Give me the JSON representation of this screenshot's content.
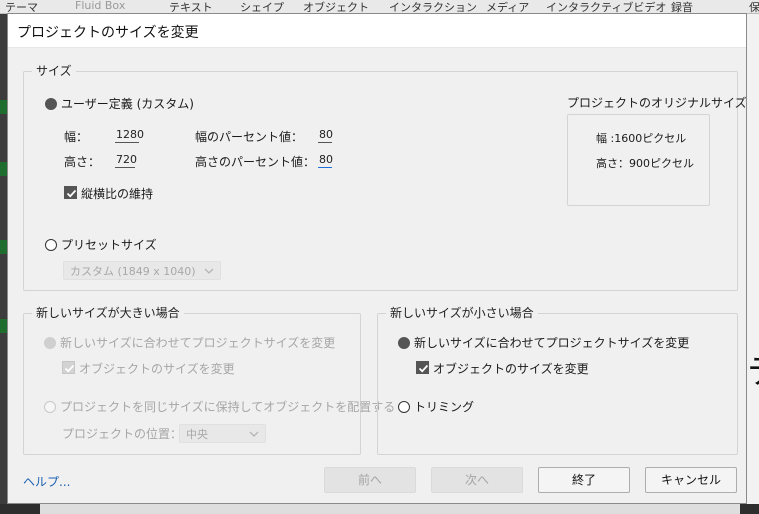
{
  "app": {
    "menu": [
      {
        "label": "テーマ",
        "dim": false
      },
      {
        "label": "Fluid Box",
        "dim": true
      },
      {
        "label": "テキスト",
        "dim": false
      },
      {
        "label": "シェイプ",
        "dim": false
      },
      {
        "label": "オブジェクト",
        "dim": false
      },
      {
        "label": "インタラクション",
        "dim": false
      },
      {
        "label": "メディア",
        "dim": false
      },
      {
        "label": "インタラクティブビデオ",
        "dim": false
      },
      {
        "label": "録音",
        "dim": false
      },
      {
        "label": "保",
        "dim": false
      }
    ],
    "right_glyph": "テ"
  },
  "dialog": {
    "title": "プロジェクトのサイズを変更",
    "size_group": {
      "legend": "サイズ",
      "custom_label": "ユーザー定義 (カスタム)",
      "custom_selected": true,
      "width_label": "幅：",
      "width_value": "1280",
      "height_label": "高さ：",
      "height_value": "720",
      "width_percent_label": "幅のパーセント値：",
      "width_percent_value": "80",
      "height_percent_label": "高さのパーセント値：",
      "height_percent_value": "80",
      "aspect_label": "縦横比の維持",
      "aspect_checked": true,
      "preset_label": "プリセットサイズ",
      "preset_selected": false,
      "preset_value": "カスタム (1849 x 1040)"
    },
    "original_size": {
      "title": "プロジェクトのオリジナルサイズ",
      "width": "幅 :1600ピクセル",
      "height": "高さ：900ピクセル"
    },
    "larger_group": {
      "legend": "新しいサイズが大きい場合",
      "option_resize": "新しいサイズに合わせてプロジェクトサイズを変更",
      "option_resize_selected": true,
      "resize_objects": "オブジェクトのサイズを変更",
      "resize_objects_checked": true,
      "option_keep": "プロジェクトを同じサイズに保持してオブジェクトを配置する",
      "position_label": "プロジェクトの位置：",
      "position_value": "中央"
    },
    "smaller_group": {
      "legend": "新しいサイズが小さい場合",
      "option_resize": "新しいサイズに合わせてプロジェクトサイズを変更",
      "option_resize_selected": true,
      "resize_objects": "オブジェクトのサイズを変更",
      "resize_objects_checked": true,
      "option_trim": "トリミング"
    },
    "footer": {
      "help": "ヘルプ...",
      "prev": "前へ",
      "next": "次へ",
      "finish": "終了",
      "cancel": "キャンセル"
    }
  }
}
